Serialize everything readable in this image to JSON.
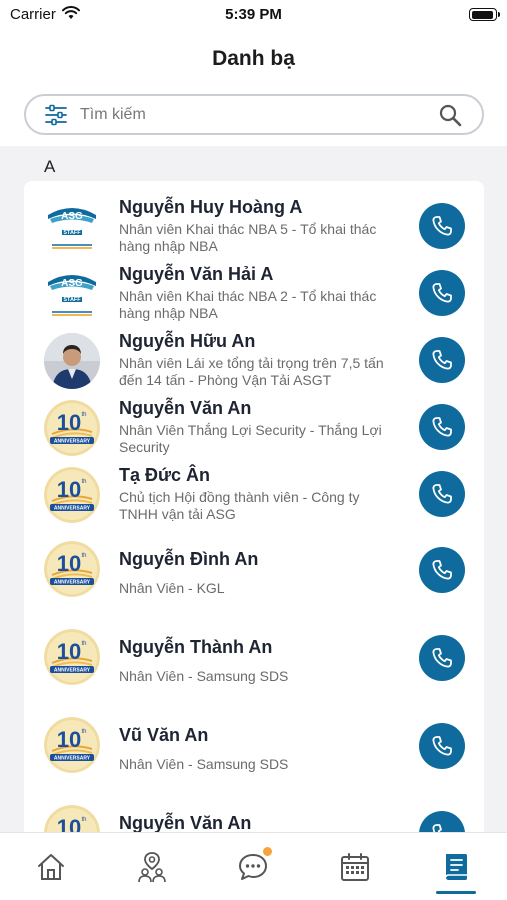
{
  "status_bar": {
    "carrier": "Carrier",
    "time": "5:39 PM"
  },
  "header": {
    "title": "Danh bạ"
  },
  "search": {
    "placeholder": "Tìm kiếm"
  },
  "section": {
    "letter": "A"
  },
  "contacts": [
    {
      "name": "Nguyễn Huy Hoàng A",
      "role": "Nhân viên Khai thác NBA 5 - Tổ khai thác hàng nhập NBA",
      "avatar": "asg-staff-logo"
    },
    {
      "name": "Nguyễn Văn Hải A",
      "role": "Nhân viên Khai thác NBA 2 - Tổ khai thác hàng nhập NBA",
      "avatar": "asg-staff-logo"
    },
    {
      "name": "Nguyễn Hữu An",
      "role": "Nhân viên Lái xe tổng tải trọng trên 7,5 tấn đến 14 tấn - Phòng Vận Tải ASGT",
      "avatar": "person-photo"
    },
    {
      "name": "Nguyễn Văn An",
      "role": "Nhân Viên Thắng Lợi Security - Thắng Lợi Security",
      "avatar": "10th-anniversary-logo"
    },
    {
      "name": "Tạ Đức Ân",
      "role": "Chủ tịch Hội đồng thành viên - Công ty TNHH vận tải ASG",
      "avatar": "10th-anniversary-logo"
    },
    {
      "name": "Nguyễn Đình An",
      "role": "Nhân Viên - KGL",
      "avatar": "10th-anniversary-logo"
    },
    {
      "name": "Nguyễn Thành An",
      "role": "Nhân Viên - Samsung SDS",
      "avatar": "10th-anniversary-logo"
    },
    {
      "name": "Vũ Văn An",
      "role": "Nhân Viên - Samsung SDS",
      "avatar": "10th-anniversary-logo"
    },
    {
      "name": "Nguyễn Văn An",
      "role": "",
      "avatar": "10th-anniversary-logo"
    }
  ],
  "logo_text": {
    "asg": "ASG",
    "staff": "STAFF",
    "anniversary_num": "10",
    "anniversary_sup": "th",
    "anniversary_word": "ANNIVERSARY"
  },
  "tabs": [
    {
      "icon": "home-icon"
    },
    {
      "icon": "map-people-icon"
    },
    {
      "icon": "chat-icon",
      "badge": true
    },
    {
      "icon": "calendar-icon"
    },
    {
      "icon": "contacts-book-icon",
      "active": true
    }
  ],
  "colors": {
    "accent": "#0f6a9e",
    "badge": "#f6a43a"
  }
}
